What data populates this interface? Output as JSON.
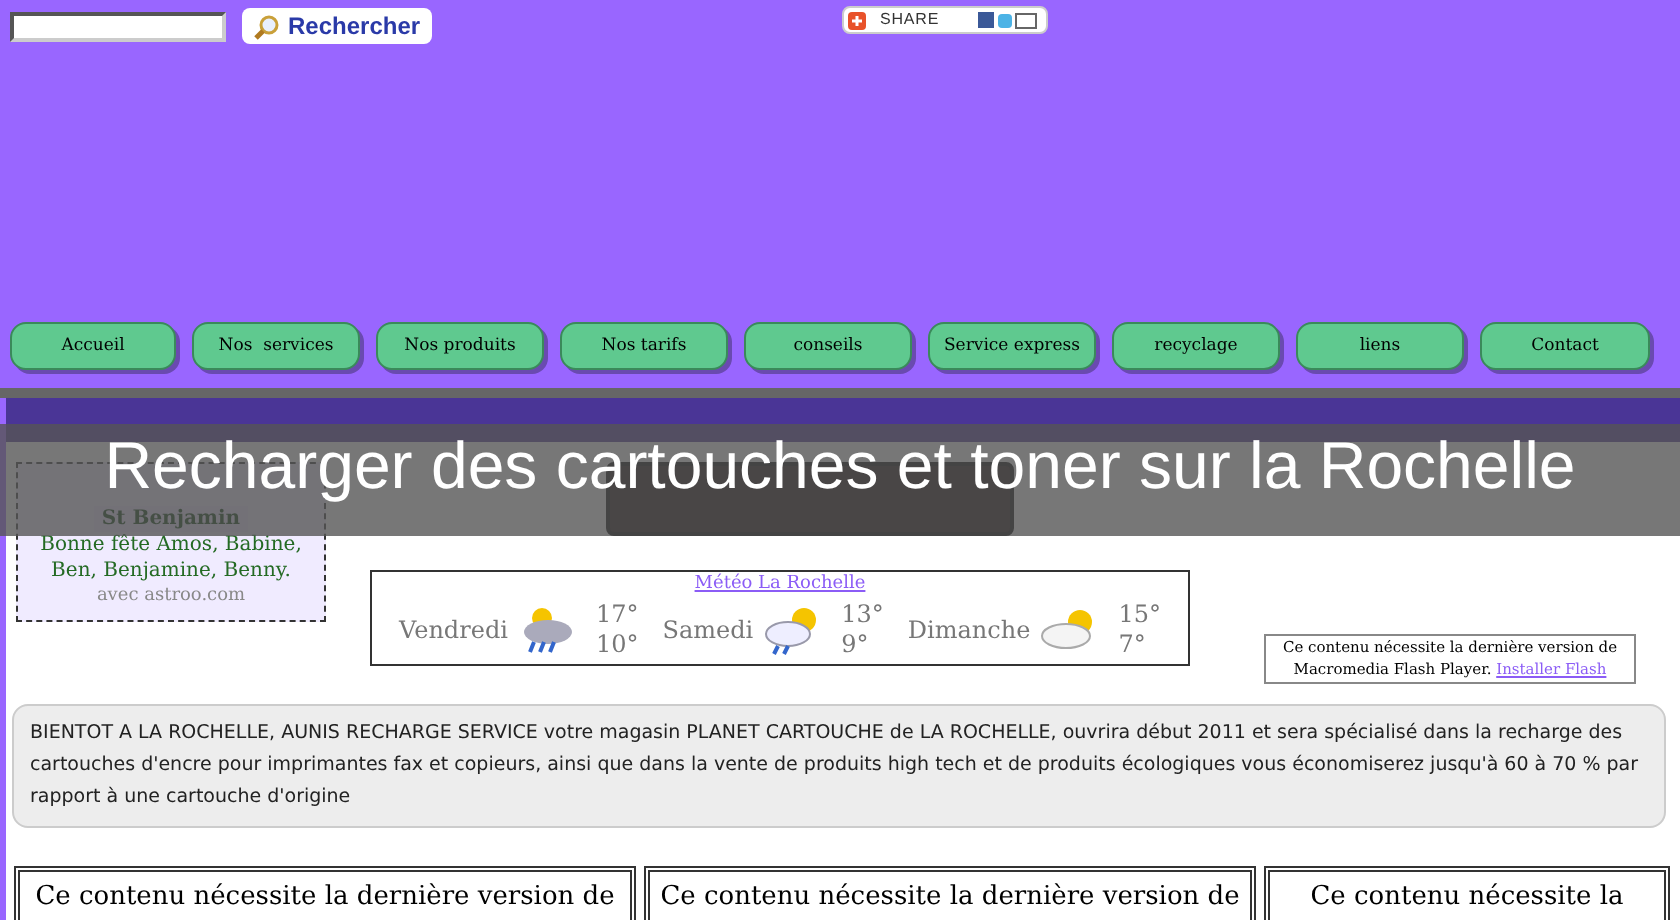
{
  "search": {
    "button": "Rechercher"
  },
  "share": {
    "label": "SHARE"
  },
  "nav": [
    {
      "label": "Accueil"
    },
    {
      "label": "Nos  services"
    },
    {
      "label": "Nos produits"
    },
    {
      "label": "Nos tarifs"
    },
    {
      "label": "conseils"
    },
    {
      "label": "Service express"
    },
    {
      "label": "recyclage"
    },
    {
      "label": "liens"
    },
    {
      "label": "Contact"
    }
  ],
  "overlay_title": "Recharger des cartouches et toner sur la Rochelle",
  "date_widget": {
    "saint": "St Benjamin",
    "wishes": "Bonne fête Amos, Babine, Ben, Benjamine, Benny.",
    "credit": "avec astroo.com"
  },
  "weather": {
    "link": "Météo La Rochelle",
    "days": [
      {
        "day": "Vendredi",
        "kind": "storm",
        "high": "17°",
        "low": "10°"
      },
      {
        "day": "Samedi",
        "kind": "showers",
        "high": "13°",
        "low": "9°"
      },
      {
        "day": "Dimanche",
        "kind": "partly-cloudy",
        "high": "15°",
        "low": "7°"
      }
    ]
  },
  "flash_notice": {
    "text": "Ce contenu nécessite la dernière version de Macromedia Flash Player.",
    "link": "Installer Flash"
  },
  "intro": "BIENTOT A LA ROCHELLE, AUNIS RECHARGE SERVICE votre magasin PLANET CARTOUCHE de LA ROCHELLE, ouvrira début 2011 et sera spécialisé dans la recharge des cartouches d'encre pour imprimantes fax et copieurs, ainsi que dans la vente de produits high tech et de produits écologiques vous économiserez jusqu'à 60 à 70 % par rapport à une cartouche d'origine",
  "bottom_boxes": [
    "Ce contenu nécessite la dernière version de",
    "Ce contenu nécessite la dernière version de",
    "Ce contenu nécessite la"
  ]
}
